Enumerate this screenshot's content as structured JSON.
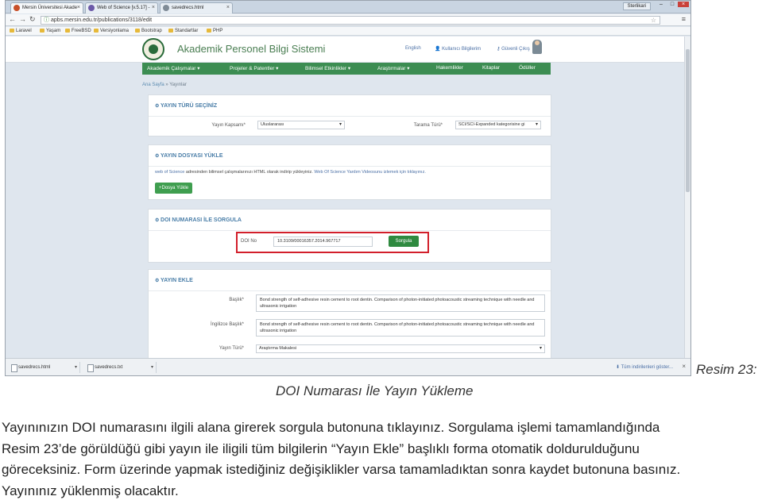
{
  "browser": {
    "tabs": [
      {
        "title": "Mersin Üniversitesi Akade",
        "color": "#c8502a"
      },
      {
        "title": "Web of Science [v.5.17] -",
        "color": "#6c5aa8"
      },
      {
        "title": "savedrecs.html",
        "color": "#7f8b96"
      }
    ],
    "user_name": "Sterlikari",
    "url": "apbs.mersin.edu.tr/publications/3118/edit",
    "bookmarks": [
      "Laravel",
      "Yaşam",
      "FreeBSD",
      "Versiyonlama",
      "Bootstrap",
      "Standartlar",
      "PHP"
    ]
  },
  "site": {
    "title": "Akademik Personel Bilgi Sistemi",
    "header_links": {
      "lang": "English",
      "user_info": "Kullanıcı Bilgilerim",
      "logout": "Güvenli Çıkış"
    },
    "nav": [
      "Akademik Çalışmalar ▾",
      "Projeler & Patentler ▾",
      "Bilimsel Etkinlikler ▾",
      "Araştırmalar ▾",
      "Hakemlikler",
      "Kitaplar",
      "Ödüller"
    ],
    "breadcrumb": {
      "home": "Ana Sayfa",
      "sep": " » ",
      "current": "Yayınlar"
    }
  },
  "panels": {
    "type": {
      "title": "YAYIN TÜRÜ SEÇİNİZ",
      "scope_label": "Yayın Kapsamı*",
      "scope_value": "Uluslararası",
      "index_label": "Tarama Türü*",
      "index_value": "SCI/SCI-Expanded kategorisine gi"
    },
    "upload": {
      "title": "YAYIN DOSYASI YÜKLE",
      "desc_link": "web of Science",
      "desc_text": " adresinden bilimsel çalışmalarınızı HTML olarak indirip yükleyiniz. ",
      "help_link": "Web Of Science Yardım Videosunu izlemek için tıklayınız.",
      "button": "+Dosya Yükle"
    },
    "doi": {
      "title": "DOI NUMARASI İLE SORGULA",
      "label": "DOI No",
      "value": "10.3109/00016357.2014.967717",
      "button": "Sorgula"
    },
    "add": {
      "title": "YAYIN EKLE",
      "title_label": "Başlık*",
      "title_value": "Bond strength of self-adhesive resin cement to root dentin. Comparison of photon-initiated photoacoustic streaming technique with needle and ultrasonic irrigation",
      "en_title_label": "İngilizce Başlık*",
      "en_title_value": "Bond strength of self-adhesive resin cement to root dentin. Comparison of photon-initiated photoacoustic streaming technique with needle and ultrasonic irrigation",
      "pubtype_label": "Yayın Türü*",
      "pubtype_value": "Araştırma Makalesi"
    }
  },
  "downloads": {
    "items": [
      "savedrecs.html",
      "savedrecs.txt"
    ],
    "show_all": "Tüm indirilenleri göster..."
  },
  "captions": {
    "figure_label": "Resim 23:",
    "figure_title": "DOI Numarası İle Yayın Yükleme"
  },
  "body_lines": [
    "Yayınınızın DOI numarasını ilgili alana girerek sorgula butonuna tıklayınız. Sorgulama işlemi tamamlandığında",
    "Resim 23’de görüldüğü gibi yayın ile iligili tüm bilgilerin “Yayın Ekle” başlıklı forma otomatik doldurulduğunu",
    "göreceksiniz. Form üzerinde yapmak istediğiniz değişiklikler varsa tamamladıktan sonra kaydet butonuna basınız.",
    "Yayınınız yüklenmiş olacaktır."
  ],
  "colors": {
    "nav_green": "#3c8d52",
    "button_green": "#3f9e4f",
    "highlight_red": "#d21f2b",
    "panel_title_blue": "#4a7ea8"
  }
}
